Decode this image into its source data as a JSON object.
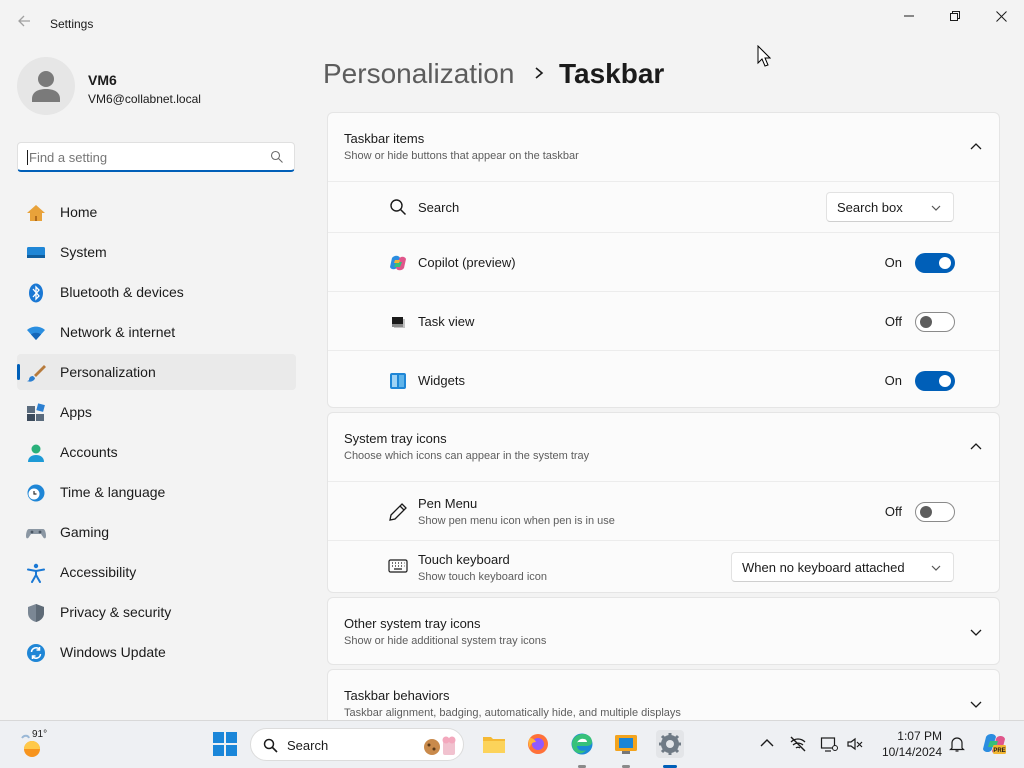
{
  "window": {
    "title": "Settings",
    "controls": [
      "minimize",
      "maximize",
      "close"
    ]
  },
  "user": {
    "name": "VM6",
    "email": "VM6@collabnet.local"
  },
  "search": {
    "placeholder": "Find a setting",
    "value": ""
  },
  "sidebar": {
    "items": [
      {
        "label": "Home",
        "icon": "home-icon"
      },
      {
        "label": "System",
        "icon": "system-icon"
      },
      {
        "label": "Bluetooth & devices",
        "icon": "bluetooth-icon"
      },
      {
        "label": "Network & internet",
        "icon": "wifi-icon"
      },
      {
        "label": "Personalization",
        "icon": "paintbrush-icon",
        "active": true
      },
      {
        "label": "Apps",
        "icon": "apps-icon"
      },
      {
        "label": "Accounts",
        "icon": "accounts-icon"
      },
      {
        "label": "Time & language",
        "icon": "clock-globe-icon"
      },
      {
        "label": "Gaming",
        "icon": "gamepad-icon"
      },
      {
        "label": "Accessibility",
        "icon": "accessibility-icon"
      },
      {
        "label": "Privacy & security",
        "icon": "shield-icon"
      },
      {
        "label": "Windows Update",
        "icon": "update-icon"
      }
    ]
  },
  "breadcrumb": {
    "parent": "Personalization",
    "current": "Taskbar"
  },
  "sections": {
    "taskbar_items": {
      "title": "Taskbar items",
      "subtitle": "Show or hide buttons that appear on the taskbar",
      "expanded": true,
      "rows": {
        "search": {
          "label": "Search",
          "dropdown_value": "Search box"
        },
        "copilot": {
          "label": "Copilot (preview)",
          "state_label": "On",
          "on": true
        },
        "task_view": {
          "label": "Task view",
          "state_label": "Off",
          "on": false
        },
        "widgets": {
          "label": "Widgets",
          "state_label": "On",
          "on": true
        }
      }
    },
    "system_tray": {
      "title": "System tray icons",
      "subtitle": "Choose which icons can appear in the system tray",
      "expanded": true,
      "rows": {
        "pen_menu": {
          "label": "Pen Menu",
          "sublabel": "Show pen menu icon when pen is in use",
          "state_label": "Off",
          "on": false
        },
        "touch_keyboard": {
          "label": "Touch keyboard",
          "sublabel": "Show touch keyboard icon",
          "dropdown_value": "When no keyboard attached"
        }
      }
    },
    "other_tray": {
      "title": "Other system tray icons",
      "subtitle": "Show or hide additional system tray icons",
      "expanded": false
    },
    "behaviors": {
      "title": "Taskbar behaviors",
      "subtitle": "Taskbar alignment, badging, automatically hide, and multiple displays",
      "expanded": false
    }
  },
  "taskbar": {
    "weather_temp": "91°",
    "search_label": "Search",
    "apps": [
      "file-explorer-icon",
      "firefox-icon",
      "edge-icon",
      "remote-desktop-icon",
      "settings-icon"
    ],
    "tray": [
      "chevron-up-icon",
      "network-offline-icon",
      "display-icon",
      "volume-muted-icon",
      "bell-icon",
      "copilot-pre-icon"
    ],
    "time": "1:07 PM",
    "date": "10/14/2024"
  },
  "colors": {
    "accent": "#005fb8",
    "background": "#f3f3f3",
    "card": "#fbfbfb"
  }
}
